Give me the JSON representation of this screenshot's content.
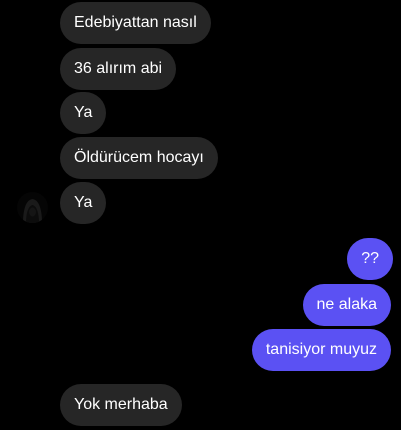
{
  "colors": {
    "background": "#000000",
    "incoming_bubble": "#262626",
    "outgoing_bubble": "#5b51f3",
    "text": "#ffffff"
  },
  "contact": {
    "avatar_icon": "profile-avatar-icon"
  },
  "messages": [
    {
      "direction": "incoming",
      "text": "Edebiyattan nasıl"
    },
    {
      "direction": "incoming",
      "text": "36 alırım abi"
    },
    {
      "direction": "incoming",
      "text": "Ya"
    },
    {
      "direction": "incoming",
      "text": "Öldürücem hocayı"
    },
    {
      "direction": "incoming",
      "text": "Ya"
    },
    {
      "direction": "outgoing",
      "text": "??"
    },
    {
      "direction": "outgoing",
      "text": "ne alaka"
    },
    {
      "direction": "outgoing",
      "text": "tanisiyor muyuz"
    },
    {
      "direction": "incoming",
      "text": "Yok merhaba"
    }
  ]
}
